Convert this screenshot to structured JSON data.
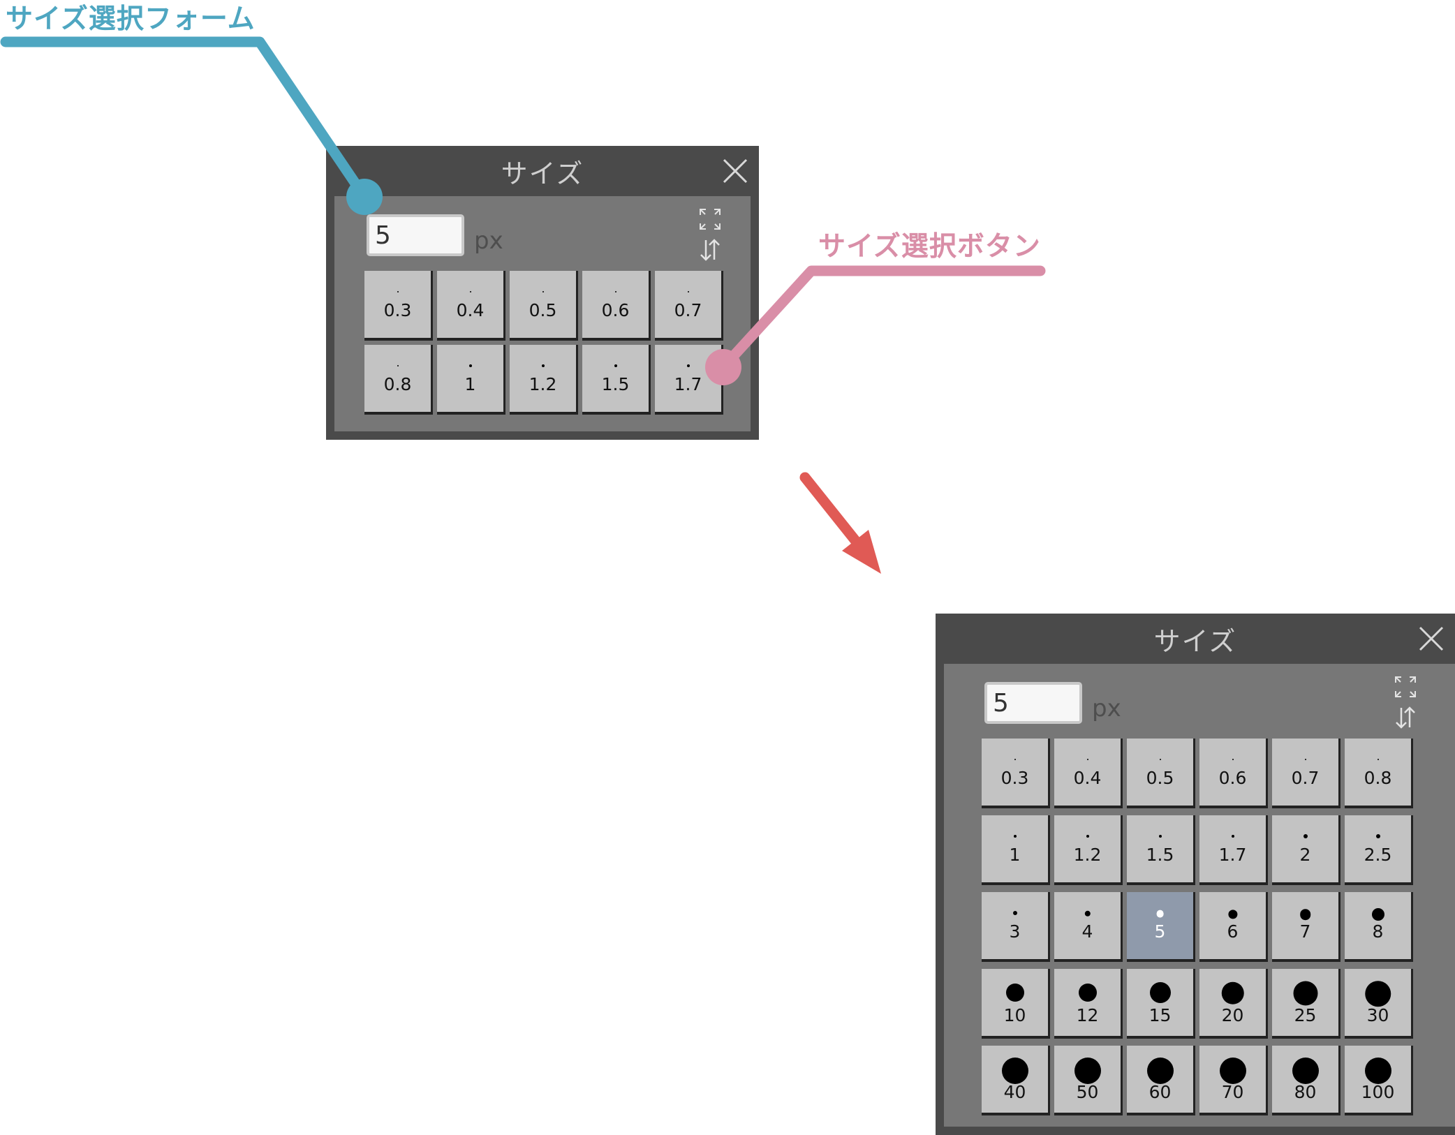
{
  "colors": {
    "form_callout": "#4ea6c1",
    "button_callout": "#d98ea7",
    "arrow": "#e05a55",
    "panel_frame": "#4a4a4a",
    "panel_body": "#777777",
    "button": "#c3c3c3",
    "selected_button": "#8f9aab"
  },
  "callouts": {
    "form_label": "サイズ選択フォーム",
    "button_label": "サイズ選択ボタン"
  },
  "small_panel": {
    "title": "サイズ",
    "input_value": "5",
    "unit": "px",
    "icons": [
      "expand-icon",
      "sort-icon",
      "close-icon"
    ],
    "buttons": [
      "0.3",
      "0.4",
      "0.5",
      "0.6",
      "0.7",
      "0.8",
      "1",
      "1.2",
      "1.5",
      "1.7"
    ]
  },
  "large_panel": {
    "title": "サイズ",
    "input_value": "5",
    "unit": "px",
    "selected": "5",
    "icons": [
      "expand-icon",
      "sort-icon",
      "close-icon"
    ],
    "buttons": [
      "0.3",
      "0.4",
      "0.5",
      "0.6",
      "0.7",
      "0.8",
      "1",
      "1.2",
      "1.5",
      "1.7",
      "2",
      "2.5",
      "3",
      "4",
      "5",
      "6",
      "7",
      "8",
      "10",
      "12",
      "15",
      "20",
      "25",
      "30",
      "40",
      "50",
      "60",
      "70",
      "80",
      "100"
    ]
  }
}
